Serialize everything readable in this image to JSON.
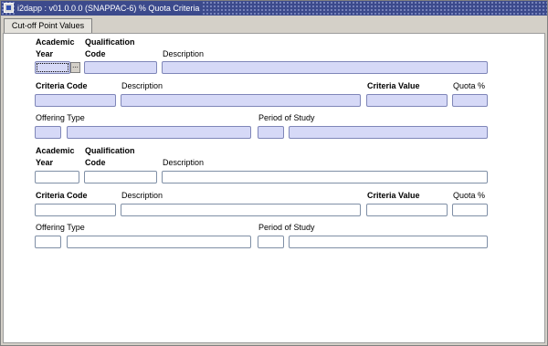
{
  "window": {
    "title": "i2dapp : v01.0.0.0 (SNAPPAC-6) % Quota Criteria",
    "icon": "oracle-forms-icon"
  },
  "tabs": [
    {
      "label": "Cut-off Point Values"
    }
  ],
  "colors": {
    "query_field": "#d6d9f7",
    "titlebar": "#3c4a8c",
    "panel": "#ffffff"
  },
  "section1": {
    "academic": "Academic",
    "year": "Year",
    "qualification": "Qualification",
    "code": "Code",
    "description": "Description",
    "criteria_code": "Criteria Code",
    "criteria_description": "Description",
    "criteria_value": "Criteria Value",
    "quota_pct": "Quota %",
    "offering_type": "Offering Type",
    "period_of_study": "Period of Study",
    "lov_button": "..."
  },
  "section2": {
    "academic": "Academic",
    "year": "Year",
    "qualification": "Qualification",
    "code": "Code",
    "description": "Description",
    "criteria_code": "Criteria Code",
    "criteria_description": "Description",
    "criteria_value": "Criteria Value",
    "quota_pct": "Quota %",
    "offering_type": "Offering Type",
    "period_of_study": "Period of Study"
  }
}
